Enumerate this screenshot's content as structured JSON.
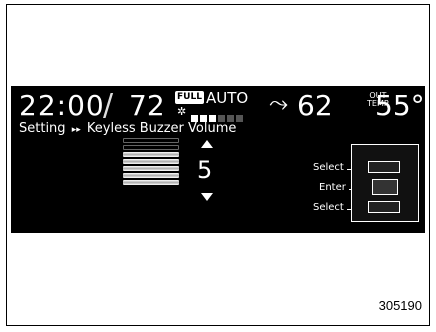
{
  "status_bar": {
    "clock": "22:00",
    "left_temp": "72",
    "fan_badge": "FULL",
    "mode": "AUTO",
    "fan_level": 0.4,
    "right_temp": "62",
    "outside_label_top": "OUT",
    "outside_label_bottom": "TEMP",
    "outside_temp": "55°F"
  },
  "breadcrumb": {
    "root": "Setting",
    "separator": "▸▸",
    "page": "Keyless Buzzer Volume"
  },
  "volume": {
    "value": "5",
    "level": 5,
    "max": 7
  },
  "controls": {
    "select_up": "Select",
    "enter": "Enter",
    "select_down": "Select"
  },
  "figure_code": "305190"
}
